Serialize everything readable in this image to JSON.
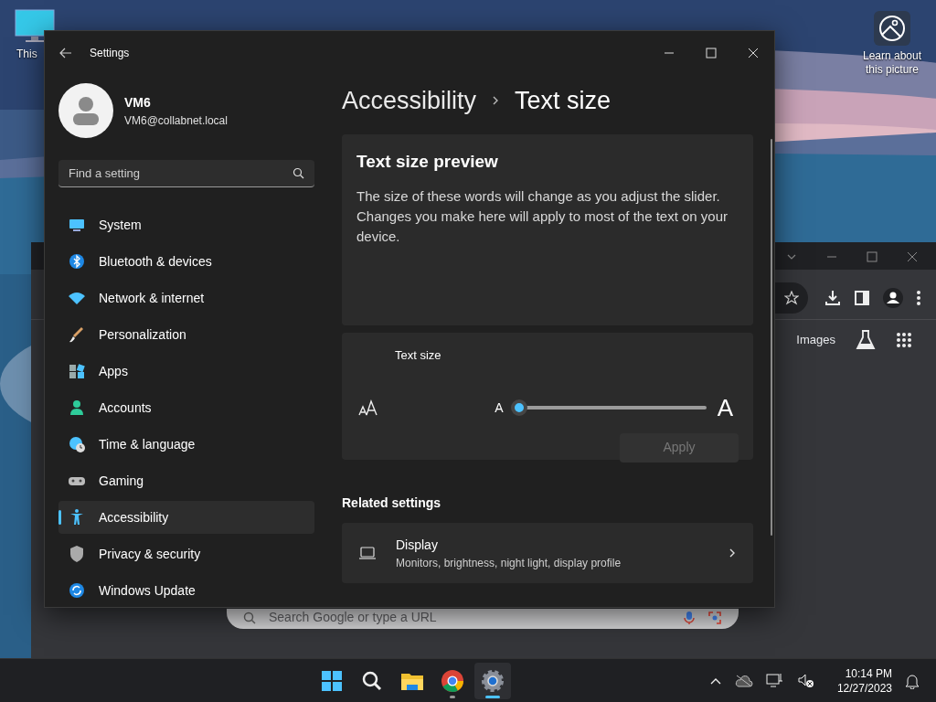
{
  "desktop": {
    "icons": [
      {
        "label": "This"
      },
      {
        "label": "Learn about this picture"
      }
    ]
  },
  "browser_window": {
    "links": [
      {
        "label": "Images"
      }
    ],
    "search": {
      "placeholder": "Search Google or type a URL"
    }
  },
  "settings_window": {
    "title": "Settings",
    "user": {
      "name": "VM6",
      "email": "VM6@collabnet.local"
    },
    "search": {
      "placeholder": "Find a setting"
    },
    "nav": [
      {
        "label": "System",
        "selected": false
      },
      {
        "label": "Bluetooth & devices",
        "selected": false
      },
      {
        "label": "Network & internet",
        "selected": false
      },
      {
        "label": "Personalization",
        "selected": false
      },
      {
        "label": "Apps",
        "selected": false
      },
      {
        "label": "Accounts",
        "selected": false
      },
      {
        "label": "Time & language",
        "selected": false
      },
      {
        "label": "Gaming",
        "selected": false
      },
      {
        "label": "Accessibility",
        "selected": true
      },
      {
        "label": "Privacy & security",
        "selected": false
      },
      {
        "label": "Windows Update",
        "selected": false
      }
    ],
    "breadcrumb": [
      "Accessibility",
      "Text size"
    ],
    "preview": {
      "title": "Text size preview",
      "body": "The size of these words will change as you adjust the slider. Changes you make here will apply to most of the text on your device."
    },
    "text_size": {
      "label": "Text size",
      "small_glyph": "A",
      "large_glyph": "A",
      "level": 0,
      "apply": {
        "label": "Apply",
        "disabled": true
      }
    },
    "related": {
      "heading": "Related settings",
      "items": [
        {
          "title": "Display",
          "subtitle": "Monitors, brightness, night light, display profile"
        }
      ]
    }
  },
  "taskbar": {
    "apps": [
      {
        "running": false,
        "selected": false
      },
      {
        "running": false,
        "selected": false
      },
      {
        "running": false,
        "selected": false
      },
      {
        "running": true,
        "selected": false
      },
      {
        "running": true,
        "selected": true
      }
    ],
    "time": "10:14 PM",
    "date": "12/27/2023"
  }
}
